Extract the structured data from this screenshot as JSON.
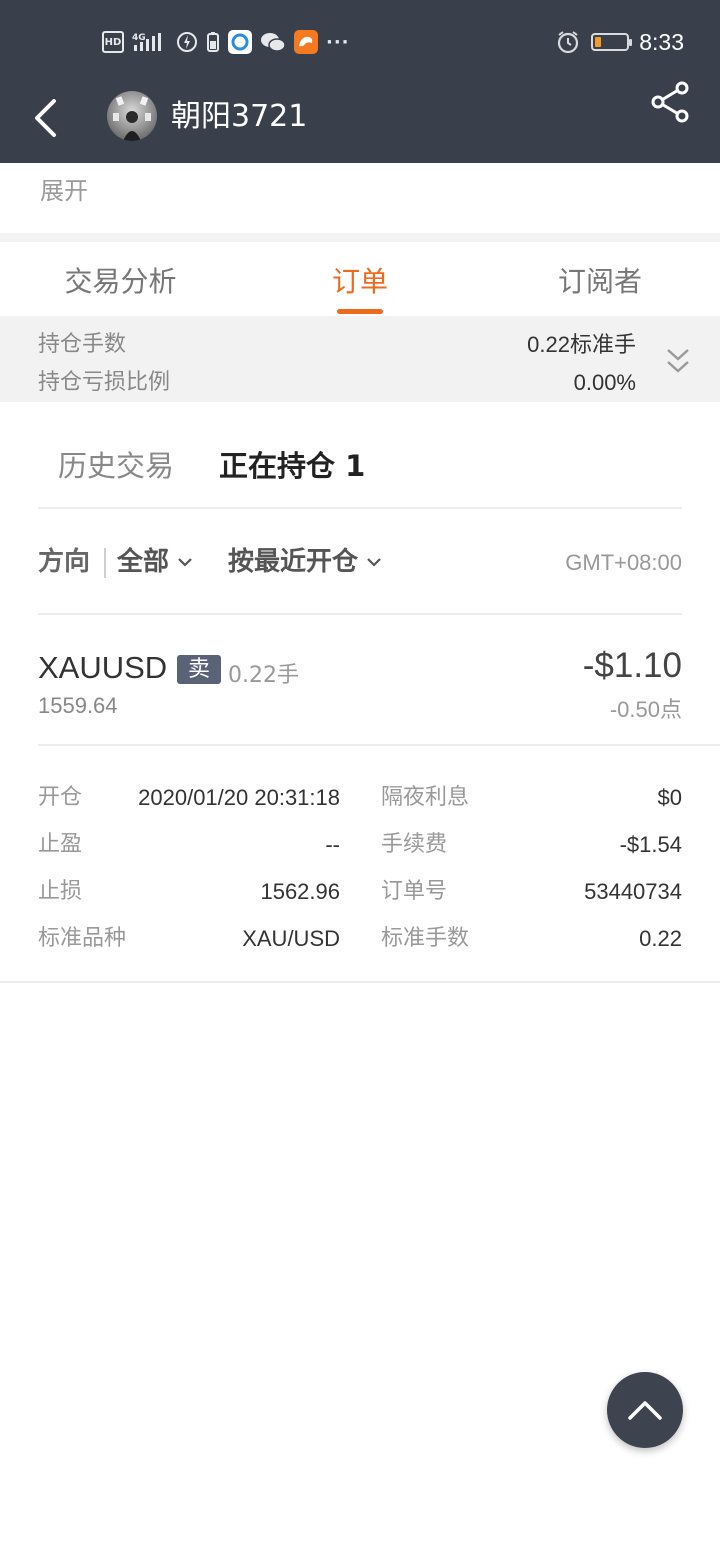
{
  "status_bar": {
    "time": "8:33",
    "icons": [
      "hd-icon",
      "4g-signal-icon",
      "data-saver-icon",
      "battery-saver-icon",
      "app-icon",
      "wechat-icon",
      "uc-browser-icon",
      "more-dots-icon",
      "alarm-icon",
      "battery-icon"
    ],
    "hd_label": "HD",
    "net_label": "4G",
    "dots": "···",
    "battery_level": 0.18
  },
  "header": {
    "title": "朝阳3721",
    "back_icon": "back-arrow-icon",
    "share_icon": "share-icon"
  },
  "profile": {
    "expand_label": "展开"
  },
  "tabs": [
    {
      "label": "交易分析",
      "active": false
    },
    {
      "label": "订单",
      "active": true
    },
    {
      "label": "订阅者",
      "active": false
    }
  ],
  "summary": {
    "lots_label": "持仓手数",
    "lots_value": "0.22标准手",
    "loss_ratio_label": "持仓亏损比例",
    "loss_ratio_value": "0.00%"
  },
  "subtabs": [
    {
      "label": "历史交易",
      "active": false
    },
    {
      "label": "正在持仓 1",
      "active": true
    }
  ],
  "filters": {
    "direction_label": "方向",
    "direction_value": "全部",
    "sort_label": "按最近开仓",
    "timezone": "GMT+08:00"
  },
  "position": {
    "symbol": "XAUUSD",
    "side": "卖",
    "lots": "0.22手",
    "price": "1559.64",
    "pnl": "-$1.10",
    "points": "-0.50点"
  },
  "details": {
    "open_label": "开仓",
    "open_value": "2020/01/20 20:31:18",
    "swap_label": "隔夜利息",
    "swap_value": "$0",
    "tp_label": "止盈",
    "tp_value": "--",
    "fee_label": "手续费",
    "fee_value": "-$1.54",
    "sl_label": "止损",
    "sl_value": "1562.96",
    "order_label": "订单号",
    "order_value": "53440734",
    "std_symbol_label": "标准品种",
    "std_symbol_value": "XAU/USD",
    "std_lots_label": "标准手数",
    "std_lots_value": "0.22"
  },
  "colors": {
    "header_bg": "#3a404b",
    "accent": "#f06a1c",
    "badge_bg": "#5a6278"
  }
}
